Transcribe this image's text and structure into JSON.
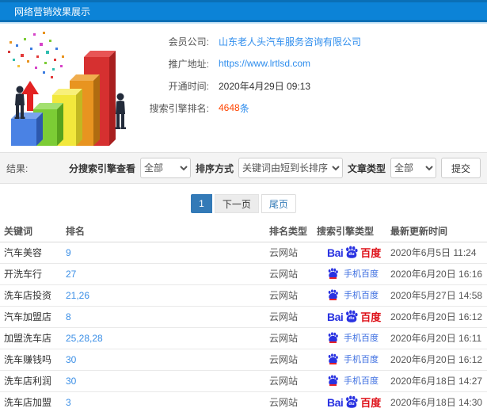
{
  "header": {
    "title": "网络营销效果展示"
  },
  "company": {
    "member_label": "会员公司:",
    "member_value": "山东老人头汽车服务咨询有限公司",
    "url_label": "推广地址:",
    "url_value": "https://www.lrtlsd.com",
    "opened_label": "开通时间:",
    "opened_value": "2020年4月29日 09:13",
    "rank_label": "搜索引擎排名:",
    "rank_count": "4648",
    "rank_unit": "条"
  },
  "filters": {
    "result_label": "结果:",
    "engine_label": "分搜索引擎查看",
    "engine_value": "全部",
    "sort_label": "排序方式",
    "sort_value": "关键词由短到长排序",
    "article_label": "文章类型",
    "article_value": "全部",
    "submit_label": "提交"
  },
  "pagination": {
    "current": "1",
    "next_label": "下一页",
    "last_label": "尾页"
  },
  "logos": {
    "baidu_prefix": "Bai",
    "baidu_du": "du",
    "baidu_suffix": "百度",
    "mobile_label": "手机百度"
  },
  "table": {
    "columns": [
      "关键词",
      "排名",
      "排名类型",
      "搜索引擎类型",
      "最新更新时间"
    ],
    "rows": [
      {
        "keyword": "汽车美容",
        "rank": "9",
        "rank_type": "云网站",
        "engine": "baidu",
        "updated": "2020年6月5日 11:24"
      },
      {
        "keyword": "开洗车行",
        "rank": "27",
        "rank_type": "云网站",
        "engine": "mobile",
        "updated": "2020年6月20日 16:16"
      },
      {
        "keyword": "洗车店投资",
        "rank": "21,26",
        "rank_type": "云网站",
        "engine": "mobile",
        "updated": "2020年5月27日 14:58"
      },
      {
        "keyword": "汽车加盟店",
        "rank": "8",
        "rank_type": "云网站",
        "engine": "baidu",
        "updated": "2020年6月20日 16:12"
      },
      {
        "keyword": "加盟洗车店",
        "rank": "25,28,28",
        "rank_type": "云网站",
        "engine": "mobile",
        "updated": "2020年6月20日 16:11"
      },
      {
        "keyword": "洗车赚钱吗",
        "rank": "30",
        "rank_type": "云网站",
        "engine": "mobile",
        "updated": "2020年6月20日 16:12"
      },
      {
        "keyword": "洗车店利润",
        "rank": "30",
        "rank_type": "云网站",
        "engine": "mobile",
        "updated": "2020年6月18日 14:27"
      },
      {
        "keyword": "洗车店加盟",
        "rank": "3",
        "rank_type": "云网站",
        "engine": "baidu",
        "updated": "2020年6月18日 14:30"
      }
    ]
  },
  "colors": {
    "header_blue": "#0c83d7",
    "link_blue": "#2e8ded",
    "count_orange": "#ff4400",
    "active_page_blue": "#337ab7",
    "baidu_blue": "#2932e1",
    "baidu_red": "#de0f17"
  }
}
